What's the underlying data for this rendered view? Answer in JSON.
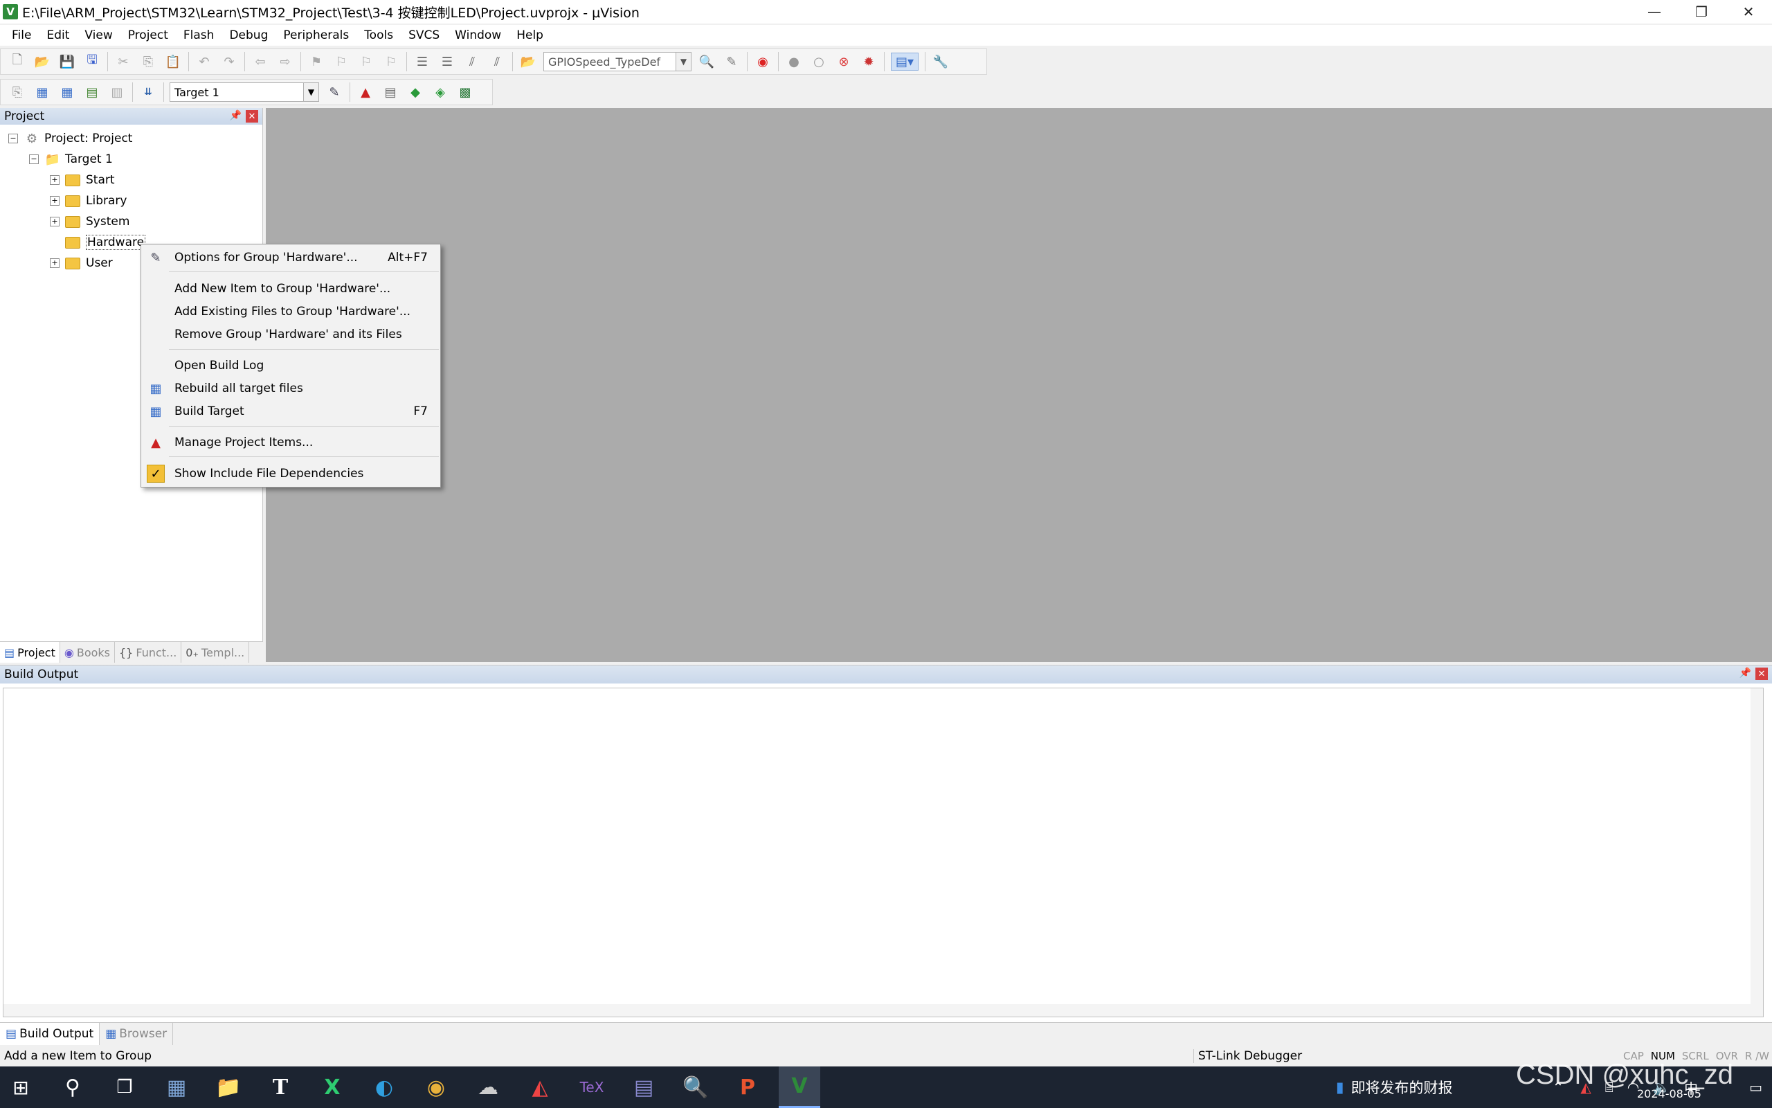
{
  "window": {
    "title": "E:\\File\\ARM_Project\\STM32\\Learn\\STM32_Project\\Test\\3-4 按键控制LED\\Project.uvprojx - µVision",
    "app_icon_label": "V",
    "controls": [
      "—",
      "❐",
      "✕"
    ]
  },
  "menubar": [
    "File",
    "Edit",
    "View",
    "Project",
    "Flash",
    "Debug",
    "Peripherals",
    "Tools",
    "SVCS",
    "Window",
    "Help"
  ],
  "toolbar1": {
    "find_combo": "GPIOSpeed_TypeDef"
  },
  "toolbar2": {
    "target_combo": "Target 1"
  },
  "project_pane": {
    "title": "Project",
    "root": "Project: Project",
    "target": "Target 1",
    "groups": [
      "Start",
      "Library",
      "System",
      "Hardware",
      "User"
    ],
    "tabs": [
      "Project",
      "Books",
      "Funct...",
      "Templ..."
    ],
    "tab_icons": [
      "▤",
      "◉",
      "{}",
      "0₊"
    ]
  },
  "context_menu": {
    "items": [
      {
        "label": "Options for Group 'Hardware'...",
        "shortcut": "Alt+F7",
        "icon": "✎"
      },
      {
        "label": "Add New  Item to Group 'Hardware'...",
        "shortcut": ""
      },
      {
        "label": "Add Existing Files to Group 'Hardware'...",
        "shortcut": ""
      },
      {
        "label": "Remove Group 'Hardware' and its Files",
        "shortcut": ""
      },
      {
        "label": "Open Build Log",
        "shortcut": ""
      },
      {
        "label": "Rebuild all target files",
        "shortcut": "",
        "icon": "▦"
      },
      {
        "label": "Build Target",
        "shortcut": "F7",
        "icon": "▦"
      },
      {
        "label": "Manage Project Items...",
        "shortcut": "",
        "icon": "▲"
      },
      {
        "label": "Show Include File Dependencies",
        "shortcut": "",
        "icon": "✓"
      }
    ]
  },
  "build_output": {
    "title": "Build Output",
    "tabs": [
      "Build Output",
      "Browser"
    ]
  },
  "statusbar": {
    "message": "Add a new Item to Group",
    "debugger": "ST-Link Debugger",
    "keys": [
      "CAP",
      "NUM",
      "SCRL",
      "OVR",
      "R /W"
    ]
  },
  "taskbar": {
    "news": "即将发布的财报",
    "date": "2024-08-05",
    "watermark": "CSDN @xuhc_zd"
  }
}
